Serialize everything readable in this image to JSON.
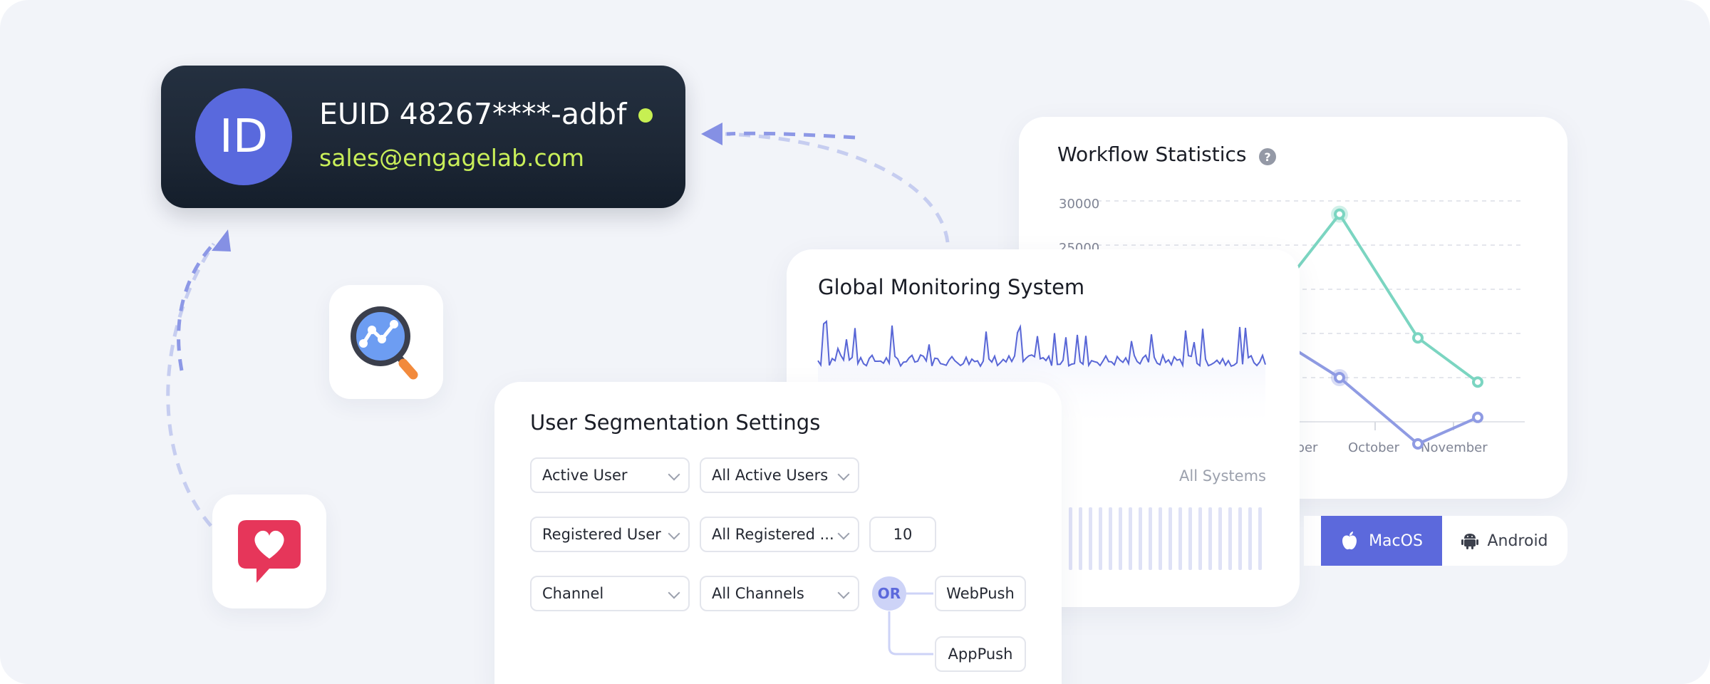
{
  "identity": {
    "avatar_text": "ID",
    "euid": "EUID 48267****-adbf",
    "email": "sales@engagelab.com"
  },
  "icons": {
    "analytics": "analytics-magnifier-icon",
    "engagement": "heart-chat-icon"
  },
  "workflow": {
    "title": "Workflow Statistics",
    "help": "?",
    "chart_data": {
      "type": "line",
      "y_ticks": [
        "30000",
        "25000"
      ],
      "x_labels": [
        "mber",
        "October",
        "November"
      ],
      "series": [
        {
          "color": "#7bd5c1",
          "values": [
            28500,
            14500,
            9500
          ]
        },
        {
          "color": "#8f9be3",
          "values": [
            10000,
            2500,
            5500
          ]
        }
      ]
    }
  },
  "os_tabs": {
    "macos": "MacOS",
    "android": "Android",
    "selected": "MacOS"
  },
  "monitoring": {
    "title": "Global Monitoring System",
    "filter_label": "All Systems"
  },
  "segmentation": {
    "title": "User Segmentation Settings",
    "rows": [
      {
        "type": "Active User",
        "scope": "All Active Users"
      },
      {
        "type": "Registered User",
        "scope": "All Registered ...",
        "value": "10"
      },
      {
        "type": "Channel",
        "scope": "All Channels"
      }
    ],
    "operator": "OR",
    "channels": [
      "WebPush",
      "AppPush"
    ]
  },
  "colors": {
    "accent": "#5c69dc",
    "id_card": "#1d2735",
    "email": "#c9ef59",
    "teal": "#7bd5c1"
  }
}
